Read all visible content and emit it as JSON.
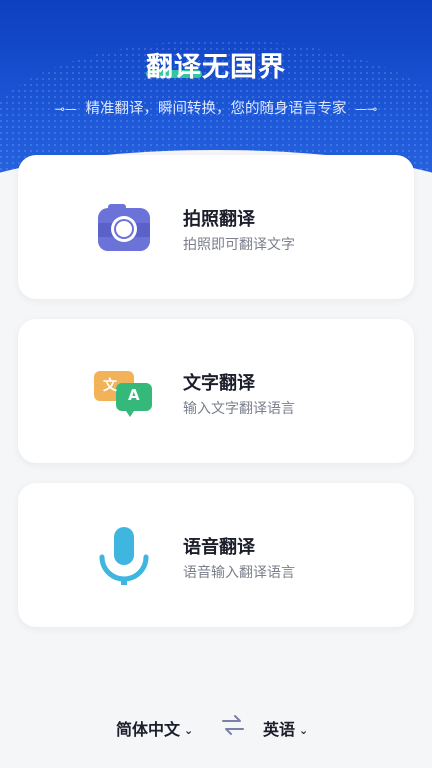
{
  "header": {
    "title": "翻译无国界",
    "subtitle": "精准翻译，瞬间转换，您的随身语言专家"
  },
  "cards": [
    {
      "title": "拍照翻译",
      "desc": "拍照即可翻译文字",
      "icon": "camera-icon"
    },
    {
      "title": "文字翻译",
      "desc": "输入文字翻译语言",
      "icon": "text-translate-icon",
      "badge_left": "文",
      "badge_right": "A"
    },
    {
      "title": "语音翻译",
      "desc": "语音输入翻译语言",
      "icon": "microphone-icon"
    }
  ],
  "language_bar": {
    "source": "简体中文",
    "target": "英语"
  },
  "colors": {
    "hero_top": "#0d3fbf",
    "accent_green": "#38d19a",
    "camera": "#6b72d8",
    "translate_orange": "#f2b259",
    "translate_green": "#34b97a",
    "mic": "#3fb6e0"
  }
}
